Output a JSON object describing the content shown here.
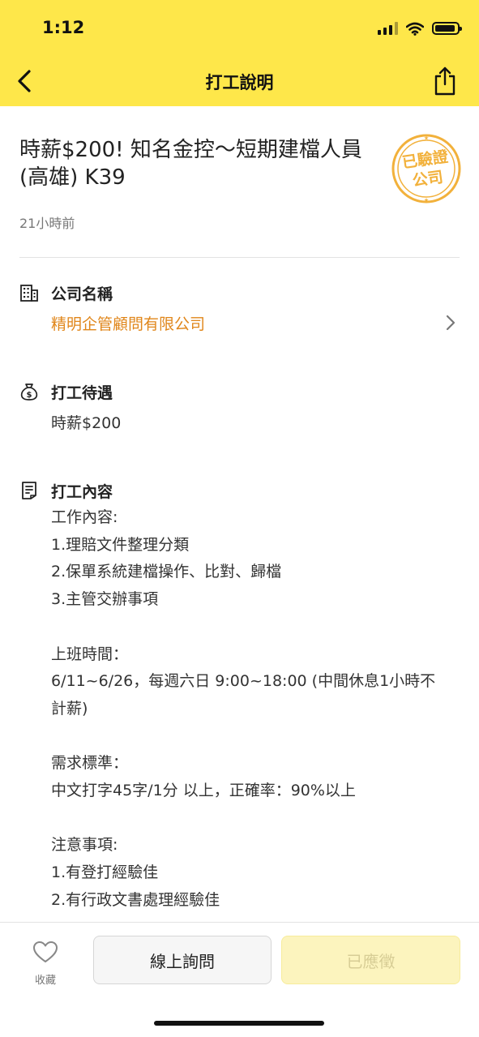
{
  "status_bar": {
    "time": "1:12"
  },
  "nav": {
    "title": "打工說明"
  },
  "job": {
    "title": "時薪$200! 知名金控～短期建檔人員 (高雄) K39",
    "posted": "21小時前",
    "verified_badge_line1": "已驗證",
    "verified_badge_line2": "公司"
  },
  "company": {
    "label": "公司名稱",
    "name": "精明企管顧問有限公司"
  },
  "pay": {
    "label": "打工待遇",
    "value": "時薪$200"
  },
  "content": {
    "label": "打工內容",
    "lines": [
      "工作內容:",
      "1.理賠文件整理分類",
      "2.保單系統建檔操作、比對、歸檔",
      "3.主管交辦事項",
      "",
      "上班時間：",
      "6/11~6/26，每週六日 9:00~18:00 (中間休息1小時不",
      "計薪)",
      "",
      "需求標準：",
      "中文打字45字/1分 以上，正確率：90%以上",
      "",
      "注意事項:",
      "1.有登打經驗佳",
      "2.有行政文書處理經驗佳"
    ]
  },
  "bottom": {
    "favorite_label": "收藏",
    "inquiry_label": "線上詢問",
    "applied_label": "已應徵"
  },
  "colors": {
    "brand_yellow": "#FEE74A",
    "link_orange": "#E0861A",
    "badge_orange": "#F2B13B"
  }
}
